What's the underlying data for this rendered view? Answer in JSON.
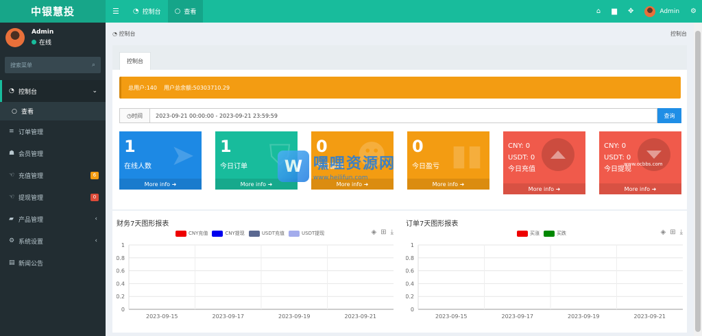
{
  "app": {
    "title": "中银慧投"
  },
  "topbar": {
    "menu_icon": "hamburger-icon",
    "tabs": [
      {
        "label": "控制台",
        "icon": "dashboard-icon"
      },
      {
        "label": "查看",
        "icon": "circle-icon"
      }
    ],
    "admin_label": "Admin"
  },
  "sidebar": {
    "user": {
      "name": "Admin",
      "status": "在线"
    },
    "search_placeholder": "搜索菜单",
    "items": [
      {
        "label": "控制台",
        "icon": "dashboard-icon"
      },
      {
        "label": "查看",
        "icon": "circle-icon"
      },
      {
        "label": "订单管理",
        "icon": "list-icon"
      },
      {
        "label": "会员管理",
        "icon": "users-icon"
      },
      {
        "label": "充值管理",
        "icon": "hand-icon",
        "badge": "6",
        "badge_color": "#f39c12"
      },
      {
        "label": "提现管理",
        "icon": "hand-icon",
        "badge": "0",
        "badge_color": "#dd4b39"
      },
      {
        "label": "产品管理",
        "icon": "product-icon"
      },
      {
        "label": "系统设置",
        "icon": "gears-icon"
      },
      {
        "label": "新闻公告",
        "icon": "news-icon"
      }
    ]
  },
  "content": {
    "breadcrumb": "控制台",
    "breadcrumb_right": "控制台",
    "tab": "控制台",
    "notice": {
      "users": "总用户:140",
      "balance": "用户总余额:50303710.29"
    },
    "time": {
      "label": "时间",
      "value": "2023-09-21 00:00:00 - 2023-09-21 23:59:59",
      "button": "查询"
    },
    "boxes": [
      {
        "value": "1",
        "label": "在线人数",
        "more": "More info",
        "color": "#1d89e4",
        "footer": "#1a7bcd"
      },
      {
        "value": "1",
        "label": "今日订单",
        "more": "More info",
        "color": "#18bc9c",
        "footer": "#16a98c"
      },
      {
        "value": "0",
        "label": "今日赢利",
        "more": "More info",
        "color": "#f39c12",
        "footer": "#db8c10"
      },
      {
        "value": "0",
        "label": "今日盈亏",
        "more": "More info",
        "color": "#f39c12",
        "footer": "#db8c10"
      },
      {
        "cny": "CNY:  0",
        "usdt": "USDT:  0",
        "label": "今日充值",
        "more": "More info",
        "color": "#f05a4b",
        "footer": "#d85143"
      },
      {
        "cny": "CNY:  0",
        "usdt": "USDT:  0",
        "label": "今日提现",
        "more": "More info",
        "color": "#f05a4b",
        "footer": "#d85143"
      }
    ],
    "watermark": {
      "cn": "嘿哩资源网",
      "en": "www.heilifun.com",
      "small": "www.ocbbs.com"
    }
  },
  "chart_data": [
    {
      "type": "line",
      "title": "财务7天图形报表",
      "x": [
        "2023-09-15",
        "2023-09-17",
        "2023-09-19",
        "2023-09-21"
      ],
      "ylim": [
        0,
        1
      ],
      "yticks": [
        "1",
        "0.8",
        "0.6",
        "0.4",
        "0.2",
        "0"
      ],
      "grid": true,
      "legend_position": "top-center",
      "series": [
        {
          "name": "CNY充值",
          "color": "#ee0000"
        },
        {
          "name": "CNY提现",
          "color": "#0000ee"
        },
        {
          "name": "USDT充值",
          "color": "#5a6890"
        },
        {
          "name": "USDT提现",
          "color": "#a3acec"
        }
      ]
    },
    {
      "type": "line",
      "title": "订单7天图形报表",
      "x": [
        "2023-09-15",
        "2023-09-17",
        "2023-09-19",
        "2023-09-21"
      ],
      "ylim": [
        0,
        1
      ],
      "yticks": [
        "1",
        "0.8",
        "0.6",
        "0.4",
        "0.2",
        "0"
      ],
      "grid": true,
      "legend_position": "top-center",
      "series": [
        {
          "name": "买涨",
          "color": "#ee0000"
        },
        {
          "name": "买跌",
          "color": "#008800"
        }
      ]
    }
  ]
}
